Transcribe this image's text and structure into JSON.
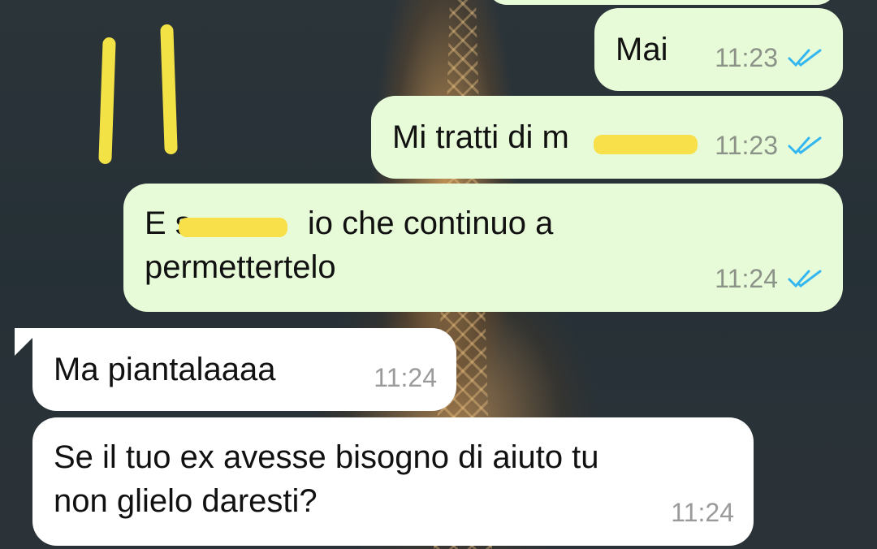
{
  "messages": [
    {
      "text": "Mai",
      "time": "11:23",
      "direction": "outgoing",
      "status": "read"
    },
    {
      "text": "Mi tratti di m",
      "time": "11:23",
      "direction": "outgoing",
      "status": "read",
      "redacted": true
    },
    {
      "text_before": "E s",
      "text_after": " io che continuo a\npermettertelo",
      "time": "11:24",
      "direction": "outgoing",
      "status": "read",
      "redacted": true
    },
    {
      "text": "Ma piantalaaaa",
      "time": "11:24",
      "direction": "incoming"
    },
    {
      "text": "Se il tuo ex avesse bisogno di aiuto tu\nnon glielo daresti?",
      "time": "11:24",
      "direction": "incoming"
    }
  ],
  "colors": {
    "outgoing_bubble": "#e8fbd8",
    "incoming_bubble": "#ffffff",
    "read_ticks": "#34b7f1",
    "highlight": "#f7e04a"
  },
  "icons": {
    "read_receipt": "double-check-icon"
  }
}
